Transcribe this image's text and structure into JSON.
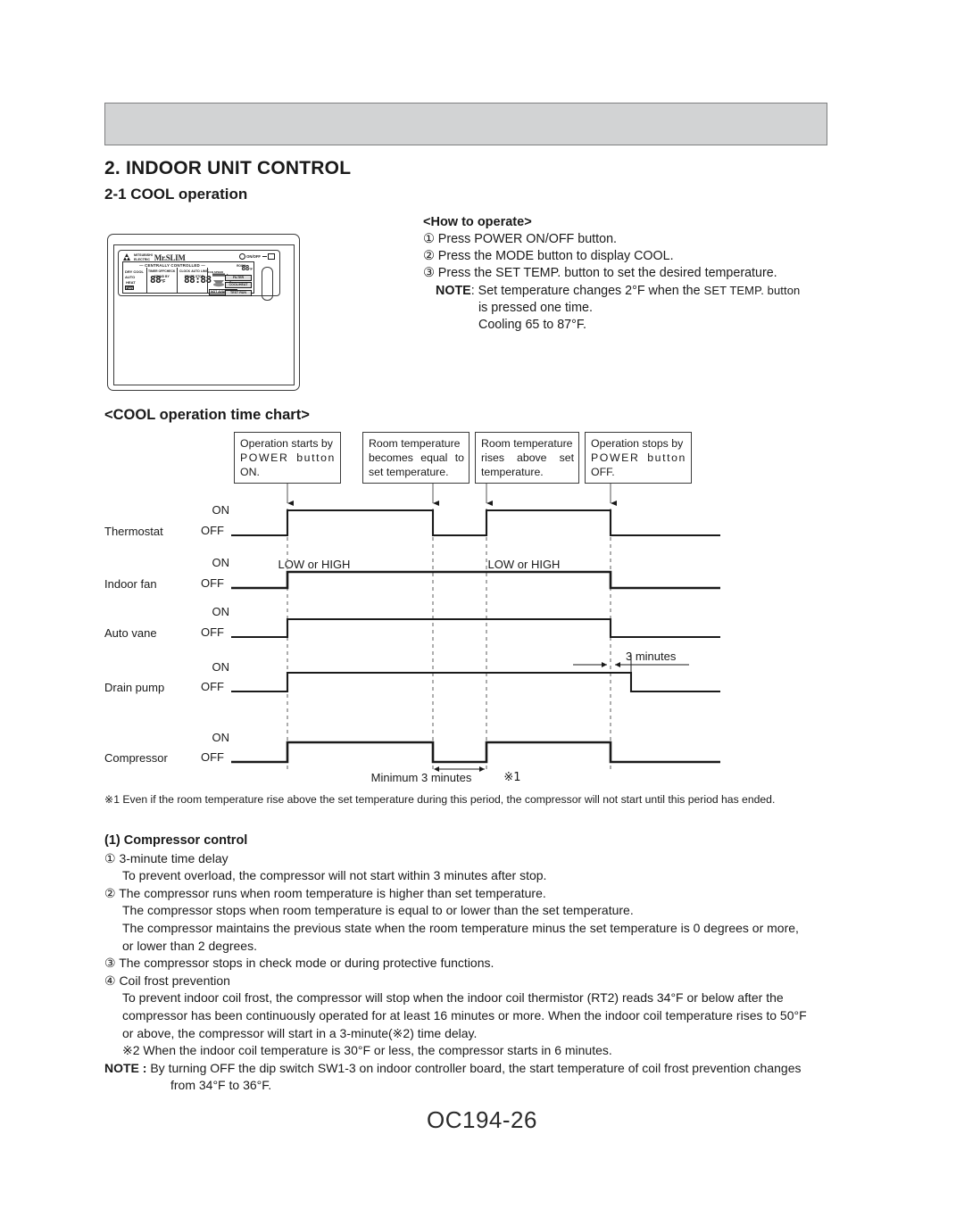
{
  "page": {
    "section_number_title": "2. INDOOR UNIT CONTROL",
    "subsection_title": "2-1 COOL operation",
    "time_chart_title": "<COOL operation time chart>",
    "page_number": "OC194-26"
  },
  "how_to_operate": {
    "heading": "<How to operate>",
    "steps": [
      "① Press POWER ON/OFF button.",
      "② Press the MODE button to display COOL.",
      "③ Press the SET TEMP. button to set the desired temperature."
    ],
    "note_label": "NOTE",
    "note_text_a": ": Set temperature changes 2°F when the ",
    "note_text_b": "SET TEMP. button",
    "note_line2": "is pressed one time.",
    "note_line3": "Cooling 65 to 87°F."
  },
  "remote": {
    "brand_line1": "MITSUBISHI",
    "brand_line2": "ELECTRIC",
    "product": "Mr.SLIM",
    "power_label": "ON/OFF",
    "lcd": {
      "centrally_controlled": "— CENTRALLY CONTROLLED —",
      "modes": [
        "DRY",
        "COOL",
        "AUTO",
        "HEAT",
        "FAN"
      ],
      "timer_labels": [
        "TIMER OFF",
        "TIMER",
        "CHECK",
        "STAND BY"
      ],
      "clock_labels": [
        "CLOCK",
        "AUTO",
        "LIMIT"
      ],
      "start_stop": [
        "START",
        "STOP"
      ],
      "temp_value": "88",
      "temp_unit": "°F",
      "clock_value": "88:88",
      "room_temp": "88",
      "room_temp_unit": "°F",
      "not_available": "NOT AVAILABLE",
      "fan_speed_label": "FAN SPEED",
      "air_direction_label": "AIR DIRECTION",
      "buttons": [
        "FILTER",
        "COOL/HEAT",
        "TEST RUN"
      ]
    }
  },
  "time_chart": {
    "events": [
      {
        "lines": [
          "Operation starts by",
          "POWER button",
          "ON."
        ]
      },
      {
        "lines": [
          "Room temperature",
          "becomes equal to",
          "set temperature."
        ]
      },
      {
        "lines": [
          "Room temperature",
          "rises above set",
          "temperature."
        ]
      },
      {
        "lines": [
          "Operation stops by",
          "POWER button",
          "OFF."
        ]
      }
    ],
    "rows": [
      {
        "label": "Thermostat",
        "on": "ON",
        "off": "OFF",
        "caption": ""
      },
      {
        "label": "Indoor fan",
        "on": "ON",
        "off": "OFF",
        "caption": "LOW or HIGH"
      },
      {
        "label": "Auto vane",
        "on": "ON",
        "off": "OFF",
        "caption": ""
      },
      {
        "label": "Drain pump",
        "on": "ON",
        "off": "OFF",
        "caption": ""
      },
      {
        "label": "Compressor",
        "on": "ON",
        "off": "OFF",
        "caption": ""
      }
    ],
    "fan_caption_1": "LOW or HIGH",
    "fan_caption_2": "LOW or HIGH",
    "drain_annotation": "3 minutes",
    "compressor_annotation": "Minimum 3 minutes",
    "compressor_annotation_ref": "※1"
  },
  "footnote": "※1 Even if the room temperature rise above the set temperature during this period, the compressor will not start until this period has ended.",
  "compressor_control": {
    "heading": "(1) Compressor control",
    "item1_title": "① 3-minute time delay",
    "item1_body": "To prevent overload, the compressor will not start within 3 minutes after stop.",
    "item2_title": "② The compressor runs when room temperature is higher than set temperature.",
    "item2_line2": "The compressor stops when room temperature is equal to or lower than the set temperature.",
    "item2_line3": "The compressor maintains the previous state when the room temperature minus the set temperature is 0 degrees or more,",
    "item2_line4": "or lower than 2 degrees.",
    "item3_title": "③ The compressor stops in check mode or during protective functions.",
    "item4_title": "④ Coil frost prevention",
    "item4_line1": "To prevent indoor coil frost, the compressor will stop when the indoor coil thermistor (RT2) reads 34°F or below after the",
    "item4_line2": "compressor has been continuously operated for at least 16 minutes or more. When the indoor coil temperature rises to 50°F",
    "item4_line3": "or above, the compressor will start in a 3-minute(※2) time delay.",
    "item4_line4": "※2  When the indoor coil temperature is 30°F or less, the compressor starts in 6 minutes.",
    "note_label": "NOTE :",
    "note_line1": " By turning OFF the dip switch SW1-3 on indoor controller board, the start temperature of coil frost prevention changes",
    "note_line2": "from 34°F to 36°F."
  },
  "colors": {
    "header_fill": "#d2d3d4",
    "line": "#1a1a1a",
    "dashed": "#8a8a8a"
  }
}
